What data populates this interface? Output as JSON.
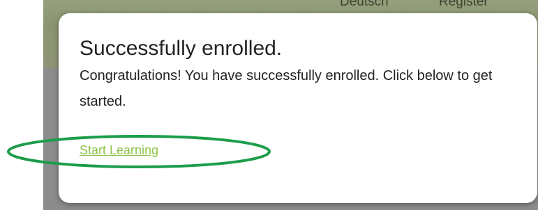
{
  "background": {
    "nav": {
      "language": "Deutsch",
      "register": "Register"
    }
  },
  "modal": {
    "title": "Successfully enrolled.",
    "message": "Congratulations! You have successfully enrolled. Click below to get started.",
    "start_link": "Start Learning"
  },
  "annotation": {
    "color": "#1c9d4a"
  },
  "colors": {
    "link": "#8bc34a",
    "text": "#222222",
    "modal_bg": "#ffffff"
  }
}
